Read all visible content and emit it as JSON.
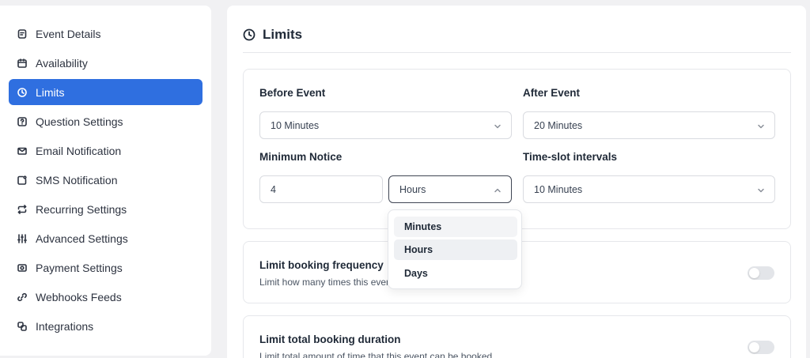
{
  "sidebar": {
    "items": [
      {
        "label": "Event Details",
        "icon": "document-icon"
      },
      {
        "label": "Availability",
        "icon": "calendar-icon"
      },
      {
        "label": "Limits",
        "icon": "clock-icon",
        "active": true
      },
      {
        "label": "Question Settings",
        "icon": "question-icon"
      },
      {
        "label": "Email Notification",
        "icon": "mail-icon"
      },
      {
        "label": "SMS Notification",
        "icon": "sms-icon"
      },
      {
        "label": "Recurring Settings",
        "icon": "repeat-icon"
      },
      {
        "label": "Advanced Settings",
        "icon": "sliders-icon"
      },
      {
        "label": "Payment Settings",
        "icon": "payment-icon"
      },
      {
        "label": "Webhooks Feeds",
        "icon": "link-icon"
      },
      {
        "label": "Integrations",
        "icon": "integrations-icon"
      }
    ]
  },
  "main": {
    "title": "Limits",
    "buffers": {
      "before_label": "Before Event",
      "before_value": "10 Minutes",
      "after_label": "After Event",
      "after_value": "20 Minutes",
      "notice_label": "Minimum Notice",
      "notice_value": "4",
      "notice_unit": "Hours",
      "interval_label": "Time-slot intervals",
      "interval_value": "10 Minutes"
    },
    "unit_dropdown": {
      "options": [
        "Minutes",
        "Hours",
        "Days"
      ],
      "selected": "Hours"
    },
    "frequency": {
      "title": "Limit booking frequency",
      "description": "Limit how many times this even",
      "enabled": false
    },
    "duration": {
      "title": "Limit total booking duration",
      "description": "Limit total amount of time that this event can be booked",
      "enabled": false
    }
  },
  "colors": {
    "accent": "#2f6fe0",
    "background": "#f1f1f3",
    "toggle_off": "#e3e5e9"
  }
}
